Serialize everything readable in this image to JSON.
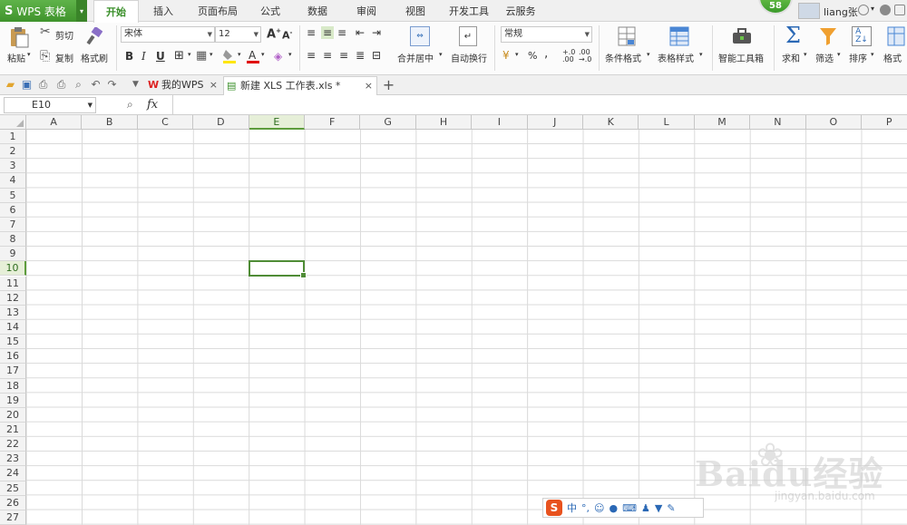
{
  "app": {
    "name": "WPS 表格",
    "logo_glyph": "S",
    "menu_arrow": "▾"
  },
  "menu_tabs": [
    "开始",
    "插入",
    "页面布局",
    "公式",
    "数据",
    "审阅",
    "视图",
    "开发工具",
    "云服务"
  ],
  "active_menu_tab": 0,
  "badge_count": "58",
  "user": {
    "name": "liang张",
    "dropdown": "▾"
  },
  "ribbon": {
    "paste_label": "粘贴",
    "cut_label": "剪切",
    "copy_label": "复制",
    "format_painter_label": "格式刷",
    "font_name": "宋体",
    "font_size": "12",
    "bold": "B",
    "italic": "I",
    "underline": "U",
    "number_format": "常规",
    "merge_center_label": "合并居中",
    "wrap_text_label": "自动换行",
    "percent": "%",
    "comma": "‚",
    "cond_format_label": "条件格式",
    "table_style_label": "表格样式",
    "smart_toolbox_label": "智能工具箱",
    "sum_label": "求和",
    "filter_label": "筛选",
    "sort_label": "排序",
    "format_label": "格式"
  },
  "doc_tabs": [
    {
      "label": "我的WPS",
      "active": false
    },
    {
      "label": "新建 XLS 工作表.xls *",
      "active": true
    }
  ],
  "add_tab": "+",
  "close_glyph": "×",
  "formula_bar": {
    "name_box": "E10",
    "fx_label": "fx",
    "formula_value": ""
  },
  "columns": [
    "A",
    "B",
    "C",
    "D",
    "E",
    "F",
    "G",
    "H",
    "I",
    "J",
    "K",
    "L",
    "M",
    "N",
    "O",
    "P"
  ],
  "rows": [
    "1",
    "2",
    "3",
    "4",
    "5",
    "6",
    "7",
    "8",
    "9",
    "10",
    "11",
    "12",
    "13",
    "14",
    "15",
    "16",
    "17",
    "18",
    "19",
    "20",
    "21",
    "22",
    "23",
    "24",
    "25",
    "26",
    "27"
  ],
  "selected_cell": {
    "column": "E",
    "row": "10"
  },
  "ime": {
    "mode": "中",
    "punct": "°,"
  },
  "watermark": {
    "brand": "Baidu经验",
    "url": "jingyan.baidu.com"
  },
  "colors": {
    "accent": "#4f8c36",
    "app_green": "#4aa436",
    "header_bg": "#f3f3f3",
    "gridline": "#dadada"
  }
}
